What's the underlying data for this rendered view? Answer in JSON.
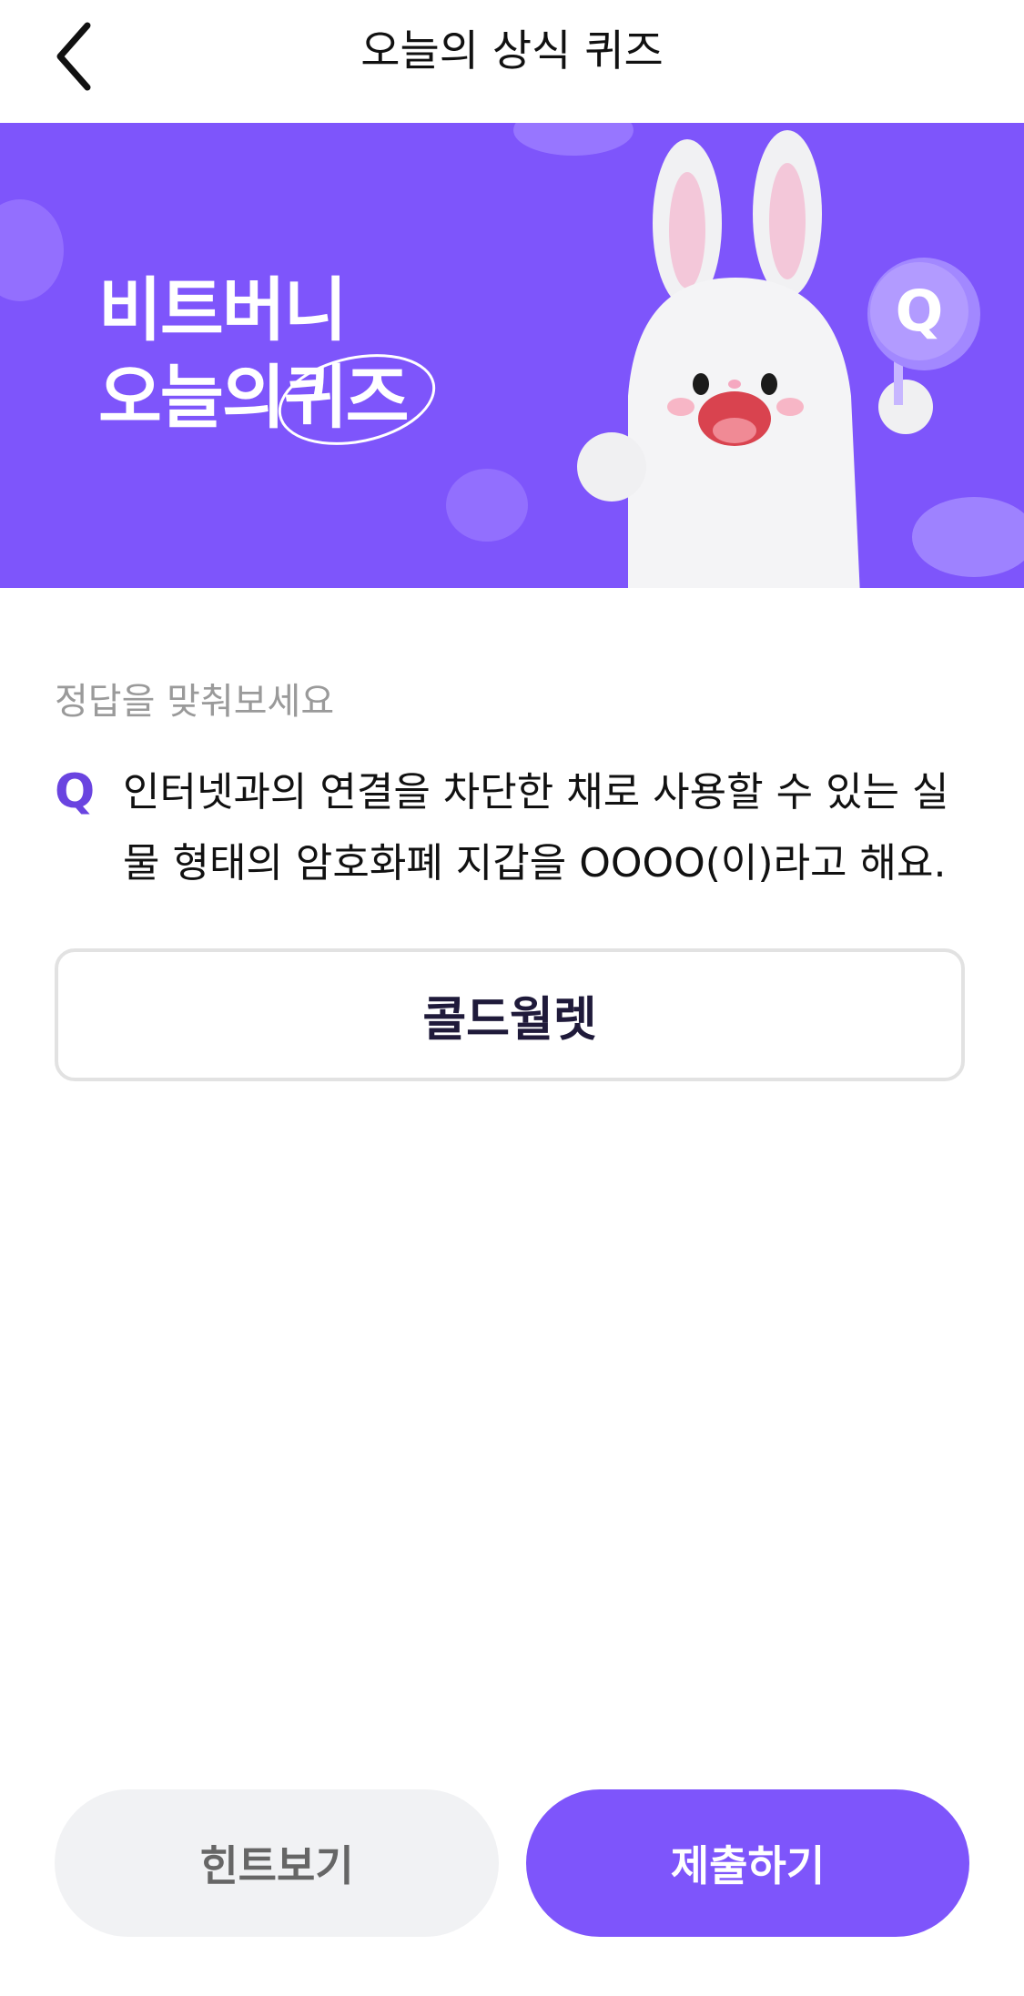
{
  "header": {
    "title": "오늘의 상식 퀴즈"
  },
  "banner": {
    "title_line1": "비트버니",
    "title_line2_prefix": "오늘의",
    "title_line2_highlight": "퀴즈",
    "badge_letter": "Q"
  },
  "quiz": {
    "instruction": "정답을 맞춰보세요",
    "q_label": "Q",
    "question": "인터넷과의 연결을 차단한 채로 사용할 수 있는 실물 형태의 암호화폐 지갑을 OOOO(이)라고 해요.",
    "answer_value": "콜드월렛"
  },
  "actions": {
    "hint_label": "힌트보기",
    "submit_label": "제출하기"
  },
  "colors": {
    "accent": "#7e55fb",
    "banner_bg": "#7e55fb",
    "hint_bg": "#f1f2f4"
  }
}
